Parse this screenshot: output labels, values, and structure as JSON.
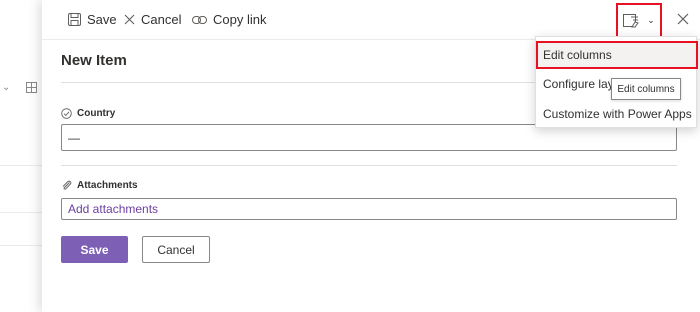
{
  "toolbar": {
    "save_label": "Save",
    "cancel_label": "Cancel",
    "copy_link_label": "Copy link"
  },
  "form": {
    "title": "New Item",
    "country": {
      "label": "Country",
      "value": "—"
    },
    "attachments": {
      "label": "Attachments",
      "link_text": "Add attachments"
    },
    "save_button": "Save",
    "cancel_button": "Cancel"
  },
  "view_menu": {
    "items": [
      {
        "label": "Edit columns"
      },
      {
        "label": "Configure layout"
      },
      {
        "label": "Customize with Power Apps"
      }
    ],
    "tooltip": "Edit columns"
  },
  "colors": {
    "accent": "#7d5fb6",
    "highlight_border": "#e81123",
    "link": "#6b3fa0"
  }
}
